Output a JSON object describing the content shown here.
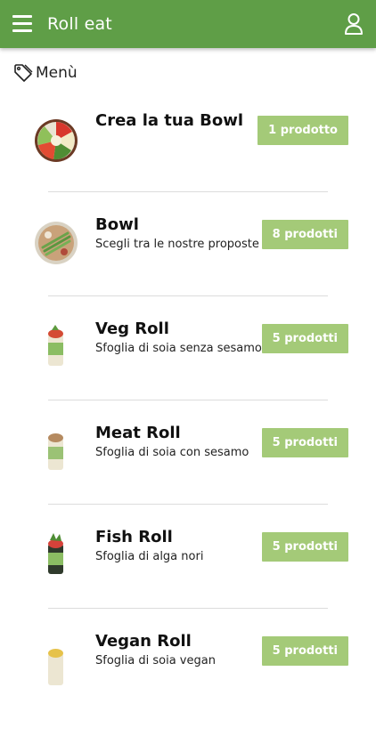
{
  "appbar": {
    "title": "Roll eat",
    "color": "#5f9e47"
  },
  "section": {
    "title": "Menù",
    "icon": "tag-icon"
  },
  "items": [
    {
      "name": "Crea la tua Bowl",
      "desc": "",
      "badge": "1 prodotto",
      "thumb": "bowl-mixed"
    },
    {
      "name": "Bowl",
      "desc": "Scegli tra le nostre proposte",
      "badge": "8 prodotti",
      "thumb": "bowl-asparagus"
    },
    {
      "name": "Veg Roll",
      "desc": "Sfoglia di soia senza sesamo",
      "badge": "5 prodotti",
      "thumb": "roll-veg"
    },
    {
      "name": "Meat Roll",
      "desc": "Sfoglia di soia con sesamo",
      "badge": "5 prodotti",
      "thumb": "roll-meat"
    },
    {
      "name": "Fish Roll",
      "desc": "Sfoglia di alga nori",
      "badge": "5 prodotti",
      "thumb": "roll-fish"
    },
    {
      "name": "Vegan Roll",
      "desc": "Sfoglia di soia vegan",
      "badge": "5 prodotti",
      "thumb": "roll-vegan"
    }
  ],
  "colors": {
    "accent": "#5f9e47",
    "badge": "#a4ca78"
  }
}
